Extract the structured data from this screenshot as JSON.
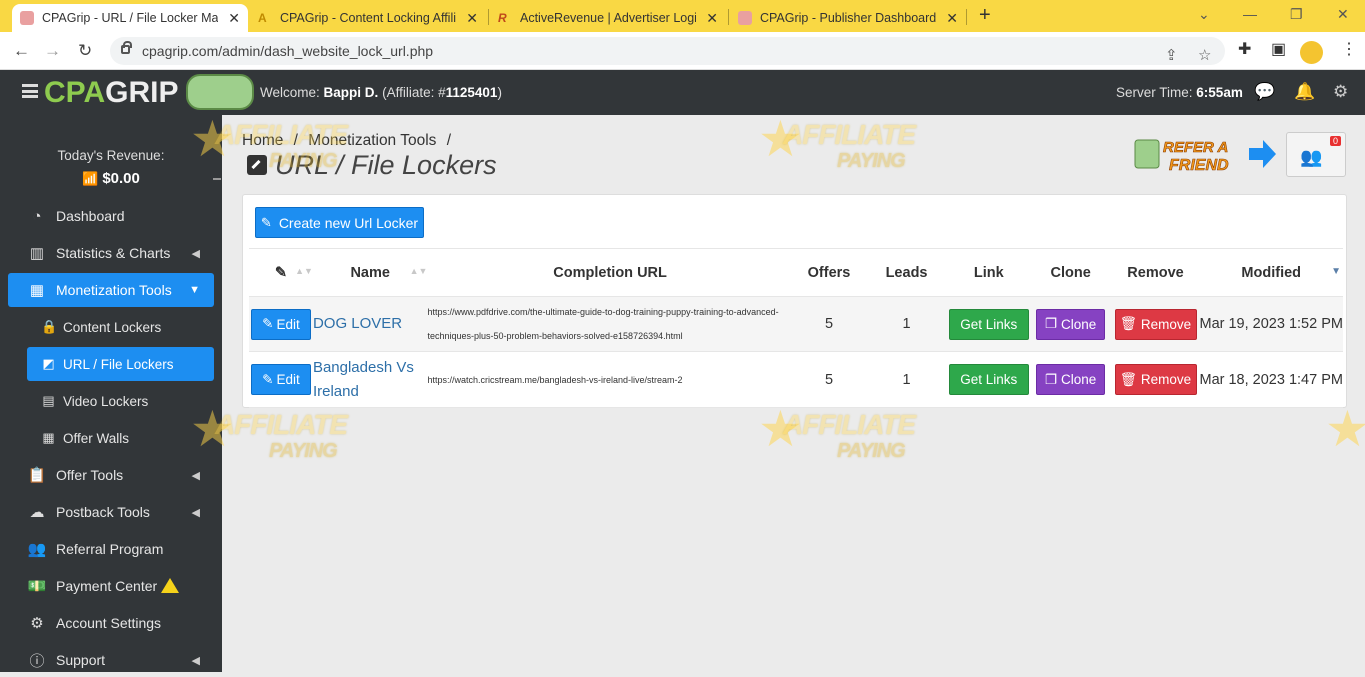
{
  "browser": {
    "tabs": [
      {
        "title": "CPAGrip - URL / File Locker Mana",
        "active": true
      },
      {
        "title": "CPAGrip - Content Locking Affilia",
        "active": false
      },
      {
        "title": "ActiveRevenue | Advertiser Login",
        "active": false
      },
      {
        "title": "CPAGrip - Publisher Dashboard",
        "active": false
      }
    ],
    "url": "cpagrip.com/admin/dash_website_lock_url.php"
  },
  "header": {
    "logo_a": "CPA",
    "logo_b": "GRIP",
    "welcome_prefix": "Welcome:",
    "user_name": "Bappi D.",
    "affiliate_prefix": "(Affiliate: #",
    "affiliate_id": "1125401",
    "affiliate_suffix": ")",
    "server_time_label": "Server Time:",
    "server_time": "6:55am"
  },
  "sidebar": {
    "revenue_label": "Today's Revenue:",
    "revenue_value": "$0.00",
    "items": [
      {
        "label": "Dashboard",
        "icon": "gauge-icon"
      },
      {
        "label": "Statistics & Charts",
        "icon": "bar-chart-icon"
      },
      {
        "label": "Monetization Tools",
        "icon": "grid-icon"
      },
      {
        "label": "Content Lockers",
        "icon": "lock-icon"
      },
      {
        "label": "URL / File Lockers",
        "icon": "external-link-icon"
      },
      {
        "label": "Video Lockers",
        "icon": "film-icon"
      },
      {
        "label": "Offer Walls",
        "icon": "table-icon"
      },
      {
        "label": "Offer Tools",
        "icon": "clipboard-icon"
      },
      {
        "label": "Postback Tools",
        "icon": "cloud-icon"
      },
      {
        "label": "Referral Program",
        "icon": "users-icon"
      },
      {
        "label": "Payment Center",
        "icon": "money-icon"
      },
      {
        "label": "Account Settings",
        "icon": "gear-icon"
      },
      {
        "label": "Support",
        "icon": "info-icon"
      }
    ]
  },
  "main": {
    "breadcrumb": [
      "Home",
      "Monetization Tools"
    ],
    "breadcrumb_sep": "/",
    "title": "URL / File Lockers",
    "refer_text": "REFER A FRIEND",
    "notification_count": "0",
    "create_button": "Create new Url Locker",
    "columns": [
      "Name",
      "Completion URL",
      "Offers",
      "Leads",
      "Link",
      "Clone",
      "Remove",
      "Modified"
    ],
    "rows": [
      {
        "edit": "Edit",
        "name": "DOG LOVER",
        "url": "https://www.pdfdrive.com/the-ultimate-guide-to-dog-training-puppy-training-to-advanced-techniques-plus-50-problem-behaviors-solved-e158726394.html",
        "offers": "5",
        "leads": "1",
        "link": "Get Links",
        "clone": "Clone",
        "remove": "Remove",
        "modified": "Mar 19, 2023 1:52 PM"
      },
      {
        "edit": "Edit",
        "name": "Bangladesh Vs Ireland",
        "url": "https://watch.cricstream.me/bangladesh-vs-ireland-live/stream-2",
        "offers": "5",
        "leads": "1",
        "link": "Get Links",
        "clone": "Clone",
        "remove": "Remove",
        "modified": "Mar 18, 2023 1:47 PM"
      }
    ]
  },
  "watermark": {
    "line1": "AFFILIATE",
    "line2": "PAYING"
  },
  "colors": {
    "accent": "#1d8ef1",
    "sidebar": "#323639",
    "tabbar": "#f9d844",
    "get_links": "#2ea84b",
    "clone": "#8642c2",
    "remove": "#dd3944"
  }
}
